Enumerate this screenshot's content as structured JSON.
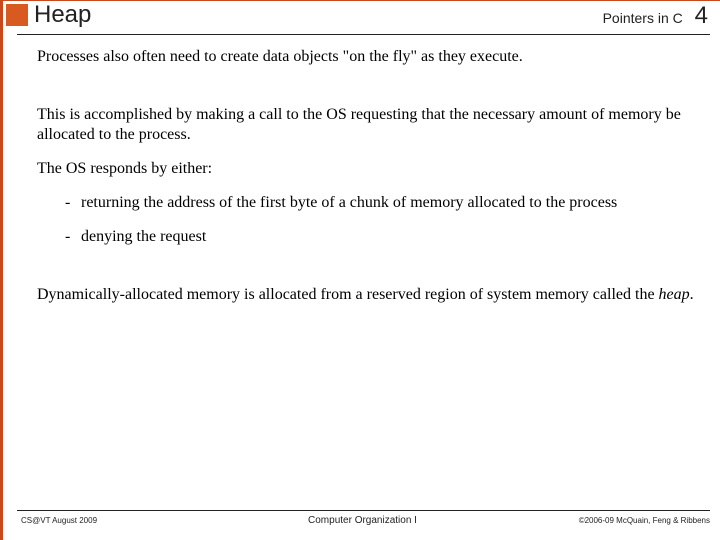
{
  "header": {
    "title": "Heap",
    "right_label": "Pointers in C",
    "page_number": "4"
  },
  "body": {
    "p1": "Processes also often need to create data objects \"on the fly\" as they execute.",
    "p2": "This is accomplished by making a call to the OS requesting that the necessary amount of memory be allocated to the process.",
    "p3": "The OS responds by either:",
    "bullets": [
      "returning the address of the first byte of a chunk of memory allocated to the process",
      "denying the request"
    ],
    "p4_pre": "Dynamically-allocated memory is allocated from a reserved region of system memory called the ",
    "p4_em": "heap",
    "p4_post": "."
  },
  "footer": {
    "left": "CS@VT August 2009",
    "center": "Computer Organization I",
    "right": "©2006-09  McQuain, Feng & Ribbens"
  }
}
